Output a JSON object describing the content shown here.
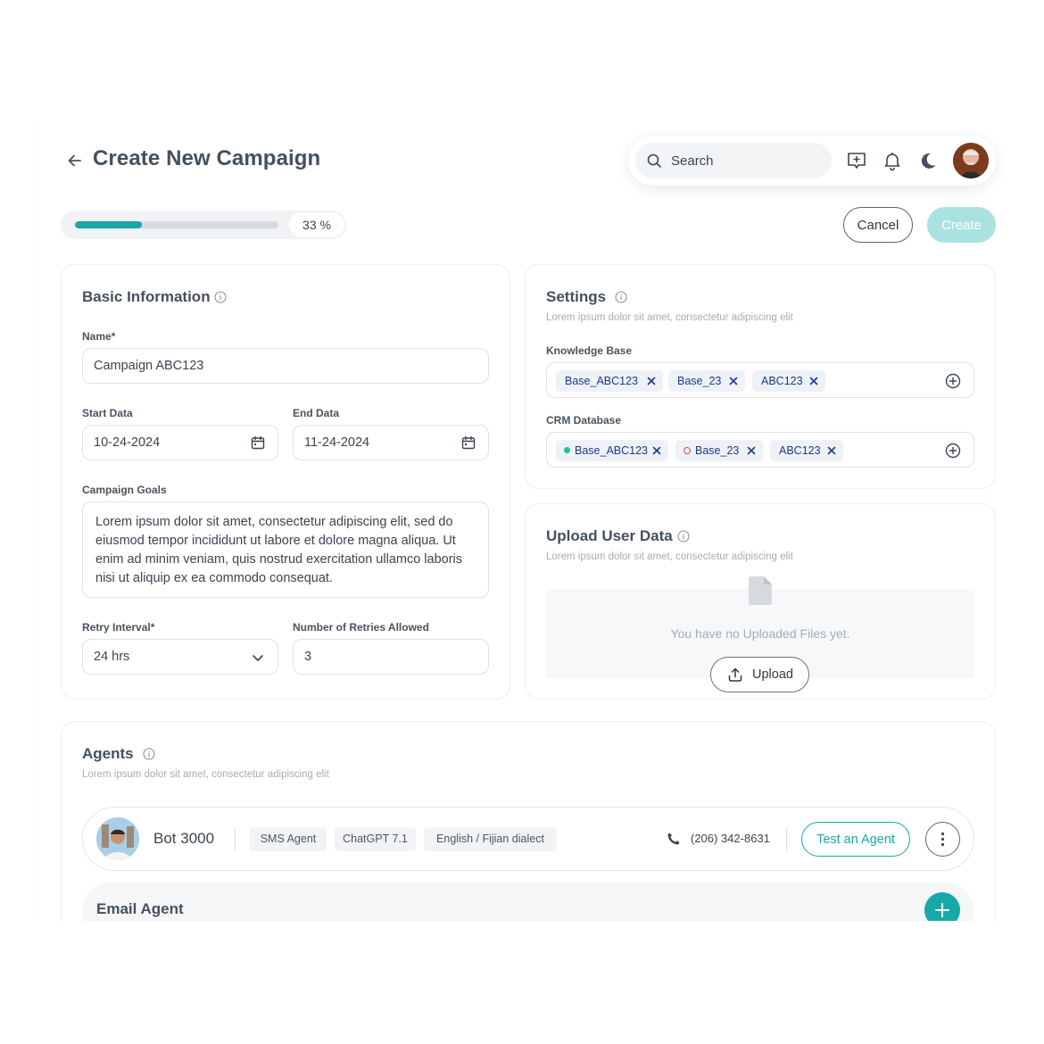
{
  "header": {
    "title": "Create New Campaign",
    "search_placeholder": "Search"
  },
  "progress": {
    "value": 0.33,
    "label": "33 %"
  },
  "actions": {
    "cancel_label": "Cancel",
    "create_label": "Create"
  },
  "basic_info": {
    "title": "Basic Information",
    "name_label": "Name*",
    "name_value": "Campaign ABC123",
    "start_label": "Start Data",
    "start_value": "10-24-2024",
    "end_label": "End Data",
    "end_value": "11-24-2024",
    "goals_label": "Campaign Goals",
    "goals_value": "Lorem ipsum dolor sit amet, consectetur adipiscing elit, sed do eiusmod tempor incididunt ut labore et dolore magna aliqua. Ut enim ad minim veniam, quis nostrud exercitation ullamco laboris nisi ut aliquip ex ea commodo consequat.",
    "retry_label": "Retry Interval*",
    "retry_value": "24 hrs",
    "retries_label": "Number of Retries Allowed",
    "retries_value": "3"
  },
  "settings": {
    "title": "Settings",
    "subtitle": "Lorem ipsum dolor sit amet, consectetur adipiscing elit",
    "kb_label": "Knowledge Base",
    "kb_tags": [
      "Base_ABC123",
      "Base_23",
      "ABC123"
    ],
    "crm_label": "CRM Database",
    "crm_tags": [
      "Base_ABC123",
      "Base_23",
      "ABC123"
    ]
  },
  "upload": {
    "title": "Upload User Data",
    "subtitle": "Lorem ipsum dolor sit amet, consectetur adipiscing elit",
    "empty_text": "You have no Uploaded Files yet.",
    "button_label": "Upload"
  },
  "agents": {
    "title": "Agents",
    "subtitle": "Lorem ipsum dolor sit amet, consectetur adipiscing elit",
    "agent": {
      "name": "Bot 3000",
      "chips": [
        "SMS Agent",
        "ChatGPT 7.1",
        "English / Fijian dialect"
      ],
      "phone": "(206) 342-8631",
      "test_label": "Test an Agent"
    },
    "email_section_title": "Email Agent"
  },
  "colors": {
    "accent": "#17a9a8",
    "create_disabled": "#a9e2e1",
    "tag_text": "#1e3a8a",
    "crm_dot_active": "#1fc38b",
    "crm_dot_inactive": "#e24a4a"
  },
  "icons": [
    "arrow-left-icon",
    "search-icon",
    "message-plus-icon",
    "bell-icon",
    "moon-icon",
    "info-icon",
    "calendar-icon",
    "chevron-down-icon",
    "close-icon",
    "plus-circle-icon",
    "file-icon",
    "upload-icon",
    "phone-icon",
    "more-vertical-icon",
    "plus-icon"
  ]
}
